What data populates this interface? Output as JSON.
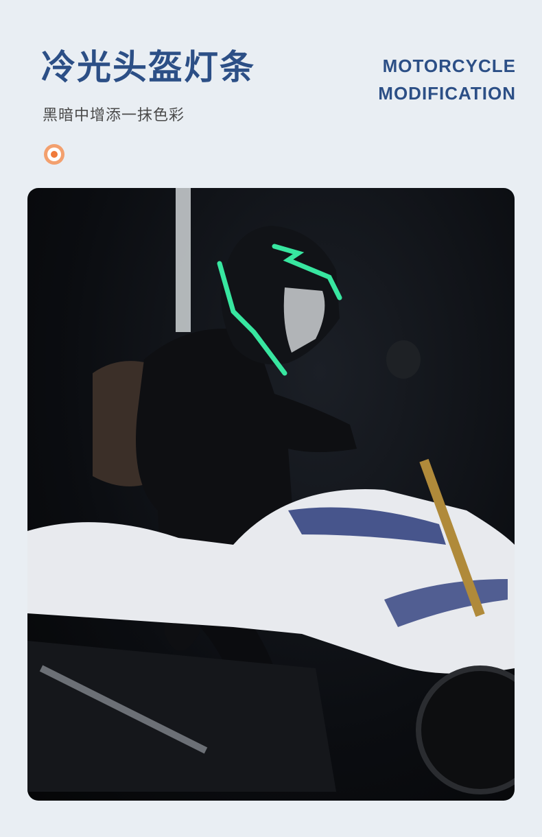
{
  "header": {
    "title": "冷光头盔灯条",
    "subtitle": "黑暗中增添一抹色彩",
    "tag_line1": "MOTORCYCLE",
    "tag_line2": "MODIFICATION",
    "icon": "target-icon"
  },
  "photo": {
    "icon": "motorcycle-rider-photo"
  },
  "colors": {
    "background": "#e9eef3",
    "title": "#2c4f86",
    "accent": "#f07a3a",
    "glow": "#38e6a0"
  }
}
